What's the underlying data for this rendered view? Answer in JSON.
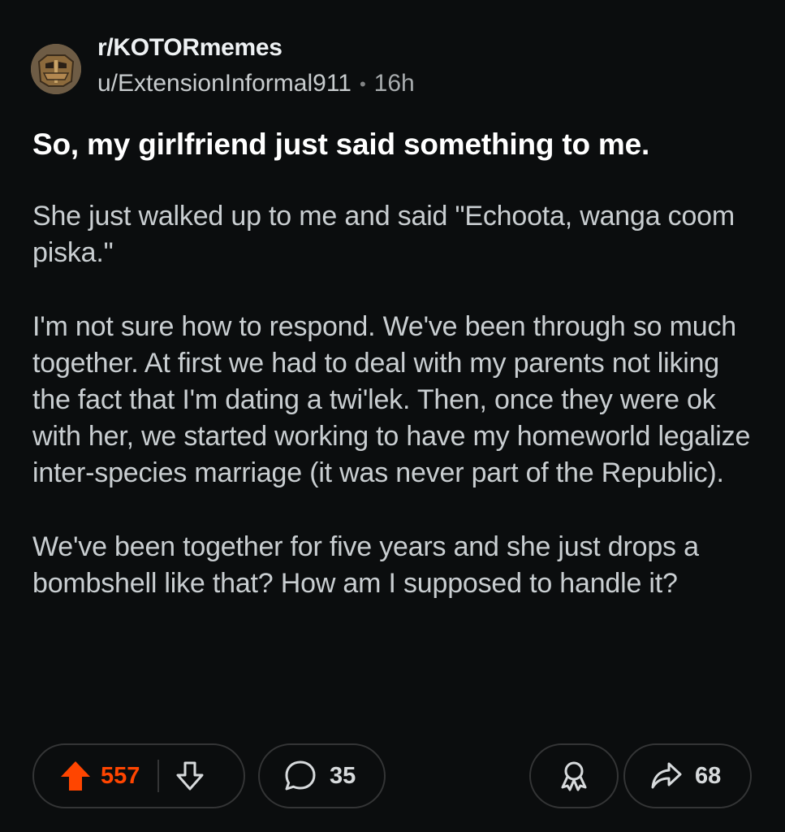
{
  "post": {
    "subreddit": "r/KOTORmemes",
    "author": "u/ExtensionInformal911",
    "separator": "•",
    "age": "16h",
    "title": "So, my girlfriend just said something to me.",
    "paragraphs": [
      "She just walked up to me and said \"Echoota, wanga coom piska.\"",
      "I'm not sure how to respond. We've been through so much together. At first we had to deal with my parents not liking the fact that I'm dating a twi'lek. Then, once they were ok with her, we started working to have my homeworld legalize inter-species marriage (it was never part of the Republic).",
      "We've been together for five years and she just drops a bombshell like that? How am I supposed to handle it?"
    ]
  },
  "actions": {
    "score": "557",
    "comments": "35",
    "shares": "68",
    "upvote_icon": "upvote-arrow-icon",
    "downvote_icon": "downvote-arrow-icon",
    "comment_icon": "comment-bubble-icon",
    "award_icon": "award-ribbon-icon",
    "share_icon": "share-arrow-icon"
  },
  "colors": {
    "background": "#0b0d0e",
    "upvote_active": "#ff4500",
    "pill_border": "#343536",
    "title_text": "#ffffff",
    "body_text": "#c9ced1"
  }
}
